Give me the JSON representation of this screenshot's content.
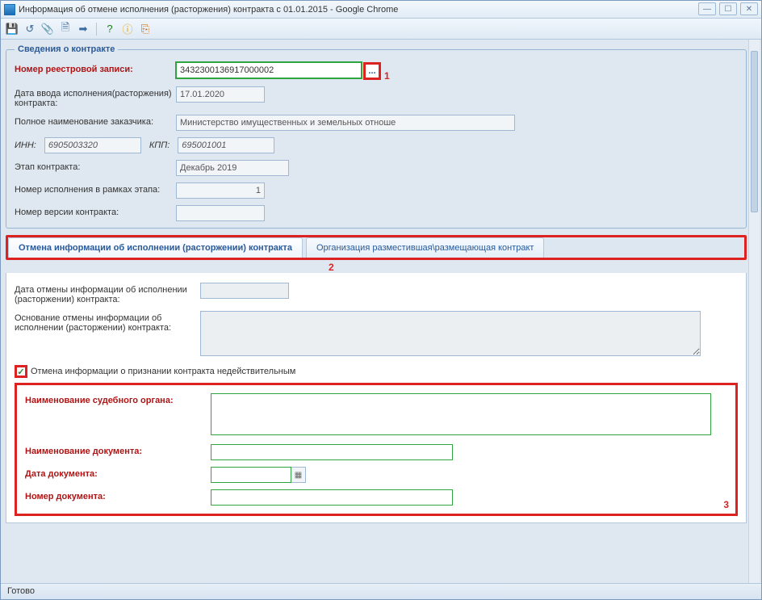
{
  "window": {
    "title": "Информация об отмене исполнения (расторжения) контракта с 01.01.2015 - Google Chrome"
  },
  "toolbar": {
    "save_title": "Сохранить",
    "refresh_title": "Обновить",
    "attach_title": "Вложения",
    "doc_title": "Документ",
    "export_title": "Экспорт",
    "help_title": "Справка",
    "info_title": "Инфо",
    "exit_title": "Выход"
  },
  "group1": {
    "legend": "Сведения о контракте",
    "registry_label": "Номер реестровой записи:",
    "registry_value": "3432300136917000002",
    "pick_label": "...",
    "annot1": "1",
    "date_in_label": "Дата ввода исполнения(расторжения) контракта:",
    "date_in_value": "17.01.2020",
    "customer_label": "Полное наименование заказчика:",
    "customer_value": "Министерство имущественных и земельных отноше",
    "inn_label": "ИНН:",
    "inn_value": "6905003320",
    "kpp_label": "КПП:",
    "kpp_value": "695001001",
    "stage_label": "Этап контракта:",
    "stage_value": "Декабрь 2019",
    "exec_num_label": "Номер исполнения в рамках этапа:",
    "exec_num_value": "1",
    "version_label": "Номер версии контракта:",
    "version_value": ""
  },
  "tabs": {
    "tab1": "Отмена информации об исполнении (расторжении) контракта",
    "tab2": "Организация разместившая\\размещающая контракт",
    "annot2": "2"
  },
  "tabbody": {
    "cancel_date_label": "Дата отмены информации об исполнении (расторжении) контракта:",
    "cancel_date_value": "",
    "reason_label": "Основание отмены информации об исполнении (расторжении) контракта:",
    "reason_value": "",
    "checkbox_label": "Отмена информации о признании контракта недействительным",
    "checkbox_checked": "✓",
    "court_label": "Наименование судебного органа:",
    "docname_label": "Наименование документа:",
    "docdate_label": "Дата документа:",
    "docnum_label": "Номер документа:",
    "annot3": "3"
  },
  "status": {
    "text": "Готово"
  }
}
